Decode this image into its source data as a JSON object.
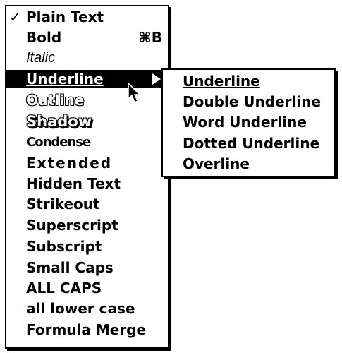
{
  "menu": {
    "items": [
      {
        "label": "Plain Text",
        "check": "✓",
        "shortcut": ""
      },
      {
        "label": "Bold",
        "check": "",
        "shortcut": "⌘B"
      },
      {
        "label": "Italic",
        "check": "",
        "shortcut": ""
      },
      {
        "label": "Underline",
        "check": "",
        "shortcut": "",
        "selected": true,
        "has_submenu": true
      },
      {
        "label": "Outline",
        "check": "",
        "shortcut": ""
      },
      {
        "label": "Shadow",
        "check": "",
        "shortcut": ""
      },
      {
        "label": "Condense",
        "check": "",
        "shortcut": ""
      },
      {
        "label": "Extended",
        "check": "",
        "shortcut": ""
      },
      {
        "label": "Hidden Text",
        "check": "",
        "shortcut": ""
      },
      {
        "label": "Strikeout",
        "check": "",
        "shortcut": ""
      },
      {
        "label": "Superscript",
        "check": "",
        "shortcut": ""
      },
      {
        "label": "Subscript",
        "check": "",
        "shortcut": ""
      },
      {
        "label": "Small Caps",
        "check": "",
        "shortcut": ""
      },
      {
        "label": "ALL CAPS",
        "check": "",
        "shortcut": ""
      },
      {
        "label": "all lower case",
        "check": "",
        "shortcut": ""
      },
      {
        "label": "Formula Merge",
        "check": "",
        "shortcut": ""
      }
    ]
  },
  "submenu": {
    "items": [
      {
        "label": "Underline"
      },
      {
        "label": "Double Underline"
      },
      {
        "label": "Word Underline"
      },
      {
        "label": "Dotted Underline"
      },
      {
        "label": "Overline"
      }
    ]
  },
  "icons": {
    "checkmark": "checkmark-icon",
    "submenu_arrow": "submenu-arrow-icon",
    "cursor": "arrow-cursor-icon"
  },
  "colors": {
    "background": "#ffffff",
    "text": "#000000",
    "highlight": "#000000",
    "highlight_text": "#ffffff"
  }
}
